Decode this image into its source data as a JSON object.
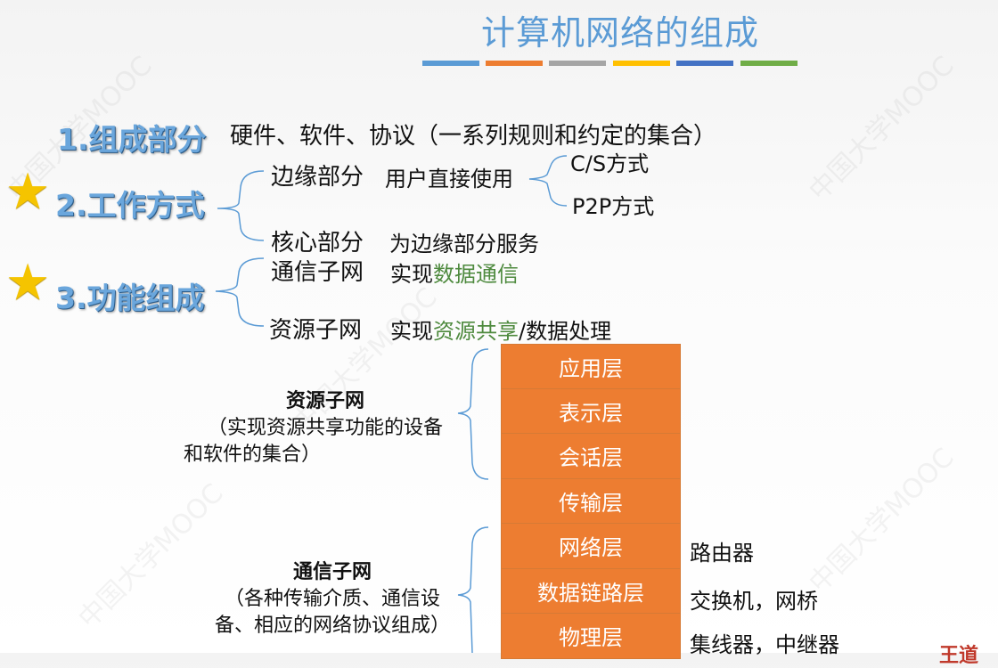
{
  "title": "计算机网络的组成",
  "color_bars": [
    "#5b9bd5",
    "#ed7d31",
    "#a5a5a5",
    "#ffc000",
    "#4472c4",
    "#70ad47"
  ],
  "section1": {
    "heading": "1.组成部分",
    "text": "硬件、软件、协议（一系列规则和约定的集合）"
  },
  "section2": {
    "heading": "2.工作方式",
    "edge": {
      "label": "边缘部分",
      "desc": "用户直接使用",
      "modes": [
        "C/S方式",
        "P2P方式"
      ]
    },
    "core": {
      "label": "核心部分",
      "desc": "为边缘部分服务"
    }
  },
  "section3": {
    "heading": "3.功能组成",
    "comm": {
      "label": "通信子网",
      "desc_prefix": "实现",
      "desc_highlight": "数据通信"
    },
    "resource": {
      "label": "资源子网",
      "desc_prefix": "实现",
      "desc_highlight": "资源共享",
      "desc_suffix": "/数据处理"
    }
  },
  "resource_block": {
    "title": "资源子网",
    "line1": "（实现资源共享功能的设备",
    "line2": "和软件的集合）"
  },
  "comm_block": {
    "title": "通信子网",
    "line1": "（各种传输介质、通信设",
    "line2": "备、相应的网络协议组成）"
  },
  "layers": [
    "应用层",
    "表示层",
    "会话层",
    "传输层",
    "网络层",
    "数据链路层",
    "物理层"
  ],
  "layer_devices": {
    "network": "路由器",
    "datalink": "交换机，网桥",
    "physical": "集线器，中继器"
  },
  "corner_text": "王道",
  "star_icon_color": "#f5c400"
}
